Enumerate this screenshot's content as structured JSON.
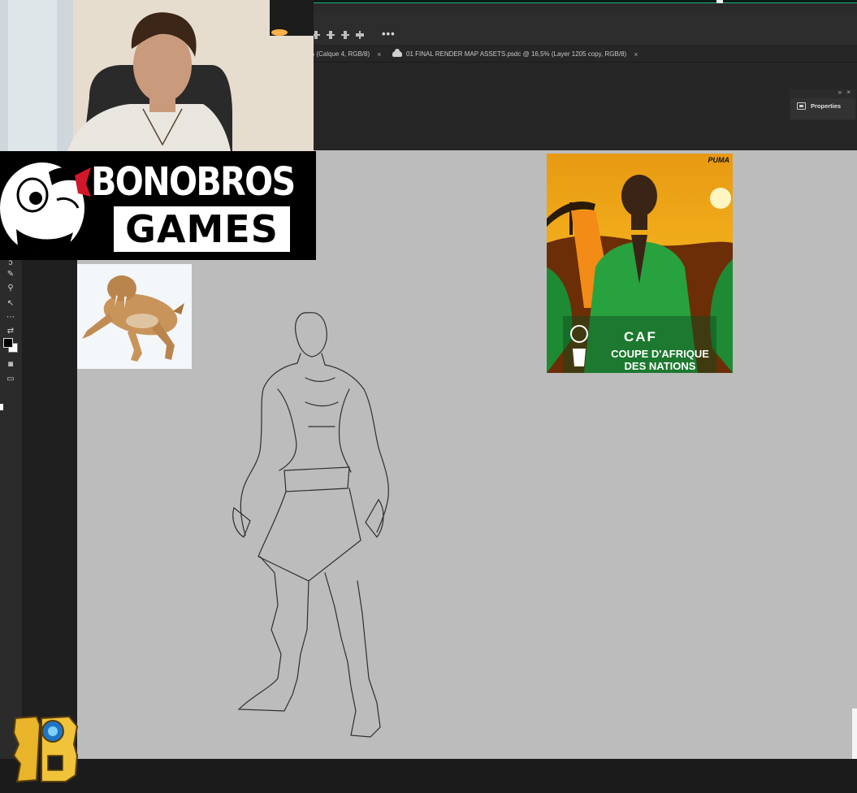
{
  "tabs": [
    {
      "label": "% (Calque 4, RGB/8)",
      "close": "×"
    },
    {
      "label": "01 FINAL RENDER MAP ASSETS.psdc @ 16,5% (Layer 1205 copy, RGB/8)",
      "close": "×"
    }
  ],
  "options_bar": {
    "more_label": "•••"
  },
  "panel": {
    "properties_label": "Properties",
    "collapse_glyph": "»  ×"
  },
  "overlay": {
    "brand_line1": "BONOBROS",
    "brand_line2": "GAMES"
  },
  "poster": {
    "brand": "PUMA",
    "caf": "CAF",
    "line1": "COUPE D'AFRIQUE",
    "line2": "DES NATIONS"
  },
  "colors": {
    "accent_line": "#1fae7a",
    "canvas_bg": "#bcbcbc",
    "ui_dark": "#262626"
  },
  "icons": [
    "lasso-icon",
    "healing-brush-icon",
    "zoom-icon",
    "direct-select-icon",
    "more-tools-icon",
    "swap-colors-icon",
    "quick-mask-icon",
    "screen-mode-icon"
  ]
}
